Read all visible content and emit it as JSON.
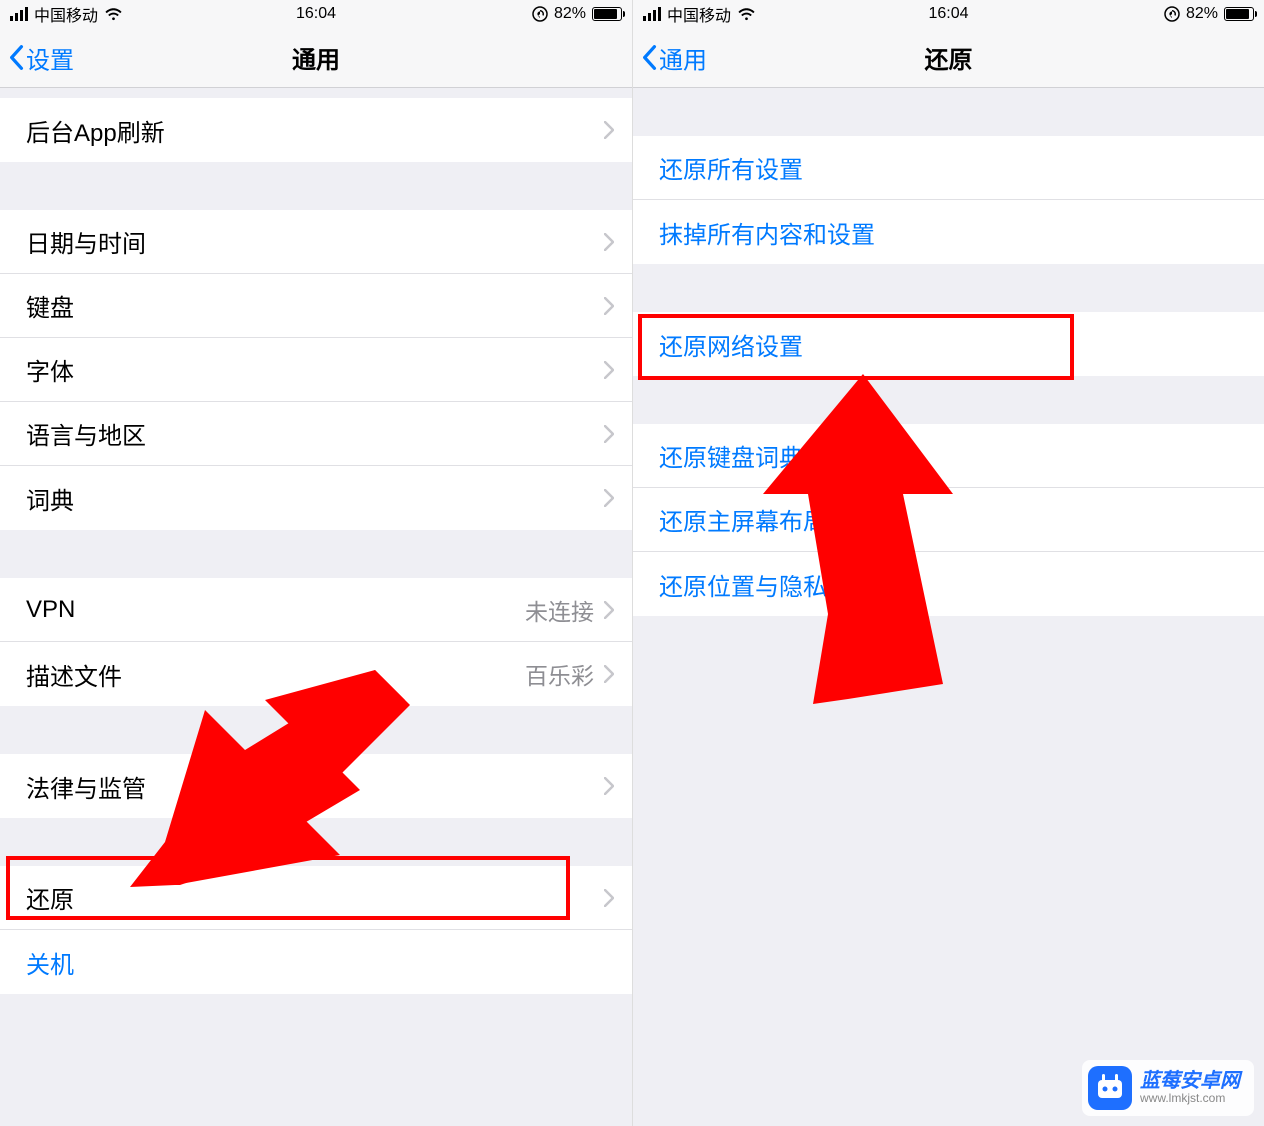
{
  "statusbar": {
    "carrier": "中国移动",
    "time": "16:04",
    "battery_pct": "82%"
  },
  "left": {
    "back_label": "设置",
    "title": "通用",
    "group1": [
      {
        "label": "后台App刷新"
      }
    ],
    "group2": [
      {
        "label": "日期与时间"
      },
      {
        "label": "键盘"
      },
      {
        "label": "字体"
      },
      {
        "label": "语言与地区"
      },
      {
        "label": "词典"
      }
    ],
    "group3": [
      {
        "label": "VPN",
        "value": "未连接"
      },
      {
        "label": "描述文件",
        "value": "百乐彩"
      }
    ],
    "group4": [
      {
        "label": "法律与监管"
      }
    ],
    "group5": [
      {
        "label": "还原"
      },
      {
        "label": "关机",
        "link": true,
        "no_chevron": true
      }
    ]
  },
  "right": {
    "back_label": "通用",
    "title": "还原",
    "group1": [
      {
        "label": "还原所有设置"
      },
      {
        "label": "抹掉所有内容和设置"
      }
    ],
    "group2": [
      {
        "label": "还原网络设置"
      }
    ],
    "group3": [
      {
        "label": "还原键盘词典"
      },
      {
        "label": "还原主屏幕布局"
      },
      {
        "label": "还原位置与隐私"
      }
    ]
  },
  "watermark": {
    "title": "蓝莓安卓网",
    "url": "www.lmkjst.com"
  },
  "colors": {
    "ios_blue": "#007aff",
    "red": "#f00"
  }
}
